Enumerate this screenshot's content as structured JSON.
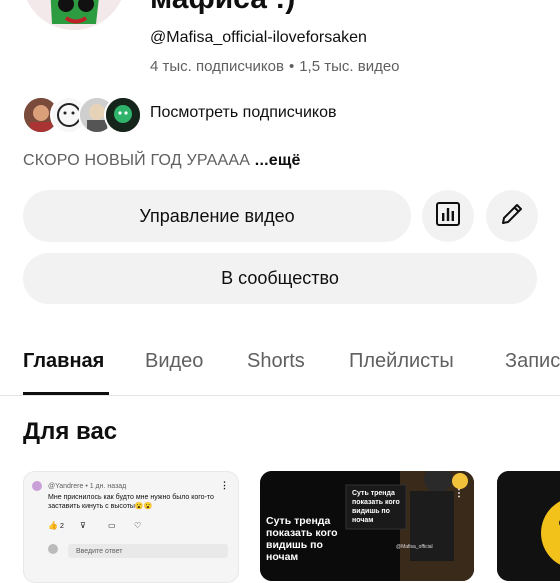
{
  "channel": {
    "title": "мафиса :)",
    "handle": "@Mafisa_official-iloveforsaken",
    "subscribers": "4 тыс. подписчиков",
    "videos": "1,5 тыс. видео",
    "stats_separator": "•",
    "view_subscribers": "Посмотреть подписчиков",
    "description": "СКОРО НОВЫЙ ГОД УРАААА",
    "more": "...ещё"
  },
  "buttons": {
    "manage": "Управление видео",
    "community": "В сообщество",
    "stats_icon": "bar-chart-icon",
    "edit_icon": "pencil-icon"
  },
  "tabs": [
    "Главная",
    "Видео",
    "Shorts",
    "Плейлисты",
    "Записи"
  ],
  "active_tab": "Главная",
  "section": {
    "title": "Для вас"
  },
  "cards": [
    {
      "type": "community-post",
      "author": "@Yandrere • 1 дн. назад",
      "text": "Мне приснилось как будто мне нужно было кого-то заставить кинуть с высоты😮😮",
      "likes": "2",
      "reply_placeholder": "Введите ответ"
    },
    {
      "type": "short",
      "caption": "Суть тренда показать кого видишь по ночам",
      "overlay_caption": "Суть тренда показать кого видишь по ночам",
      "channel_label": "@Mafisa_official"
    },
    {
      "type": "short"
    }
  ],
  "colors": {
    "background": "#ffffff",
    "text_primary": "#0f0f0f",
    "text_secondary": "#606060",
    "pill_bg": "#f2f2f2"
  }
}
